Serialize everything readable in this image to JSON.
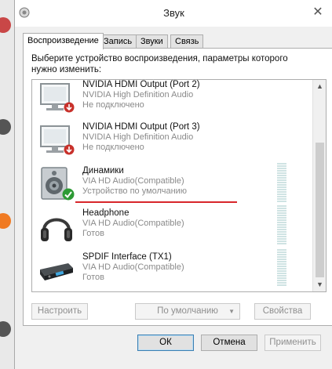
{
  "window": {
    "title": "Звук",
    "title_icon": "speaker-gear-icon",
    "close_glyph": "✕"
  },
  "tabs": [
    {
      "label": "Воспроизведение",
      "active": true
    },
    {
      "label": "Запись",
      "active": false
    },
    {
      "label": "Звуки",
      "active": false
    },
    {
      "label": "Связь",
      "active": false
    }
  ],
  "instruction": "Выберите устройство воспроизведения, параметры которого нужно изменить:",
  "devices": [
    {
      "name": "NVIDIA HDMI Output (Port 2)",
      "driver": "NVIDIA High Definition Audio",
      "status": "Не подключено",
      "icon": "monitor-icon",
      "badge": "disconnected-badge-icon"
    },
    {
      "name": "NVIDIA HDMI Output (Port 3)",
      "driver": "NVIDIA High Definition Audio",
      "status": "Не подключено",
      "icon": "monitor-icon",
      "badge": "disconnected-badge-icon"
    },
    {
      "name": "Динамики",
      "driver": "VIA HD Audio(Compatible)",
      "status": "Устройство по умолчанию",
      "icon": "speaker-icon",
      "badge": "default-check-badge-icon"
    },
    {
      "name": "Headphone",
      "driver": "VIA HD Audio(Compatible)",
      "status": "Готов",
      "icon": "headphones-icon",
      "badge": ""
    },
    {
      "name": "SPDIF Interface (TX1)",
      "driver": "VIA HD Audio(Compatible)",
      "status": "Готов",
      "icon": "receiver-icon",
      "badge": ""
    }
  ],
  "buttons": {
    "configure": "Настроить",
    "set_default": "По умолчанию",
    "properties": "Свойства",
    "ok": "ОК",
    "cancel": "Отмена",
    "apply": "Применить"
  },
  "colors": {
    "highlight_underline": "#d8262a",
    "check_badge": "#2c9a34",
    "disconnected_badge": "#c8312b"
  }
}
